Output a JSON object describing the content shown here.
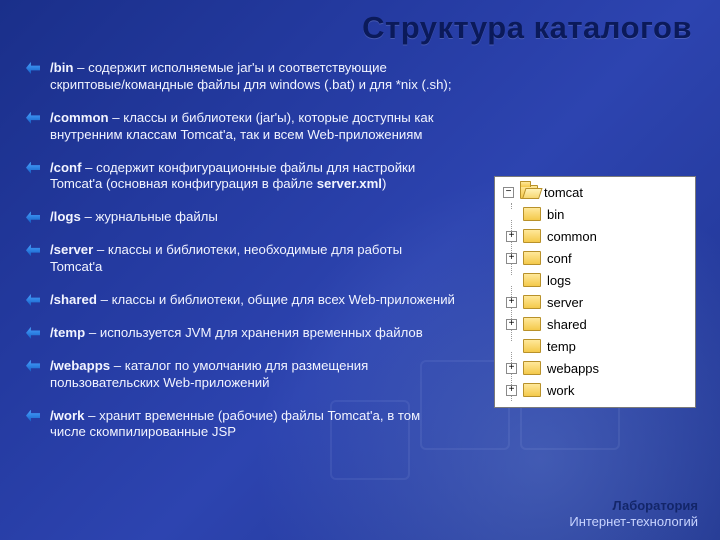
{
  "title": "Структура каталогов",
  "bullets": [
    {
      "name": "/bin",
      "desc": " – содержит исполняемые jar'ы и соответствующие скриптовые/командные файлы для windows (.bat) и для *nix (.sh);"
    },
    {
      "name": "/common",
      "desc": " – классы и библиотеки (jar'ы), которые доступны как внутренним классам Tomcat'а, так и всем Web-приложениям"
    },
    {
      "name": "/conf",
      "desc": " – содержит конфигурационные файлы для настройки Tomcat'а (основная конфигурация в файле ",
      "hl": "server.xml",
      "desc2": ")"
    },
    {
      "name": "/logs",
      "desc": " – журнальные файлы"
    },
    {
      "name": "/server",
      "desc": " – классы и библиотеки, необходимые для работы Tomcat'а"
    },
    {
      "name": "/shared",
      "desc": " – классы и библиотеки, общие для всех Web-приложений"
    },
    {
      "name": "/temp",
      "desc": " – используется JVM для хранения временных файлов"
    },
    {
      "name": "/webapps",
      "desc": " – каталог по умолчанию для размещения пользовательских Web-приложений"
    },
    {
      "name": "/work",
      "desc": " – хранит временные (рабочие) файлы Tomcat'а, в том числе скомпилированные JSP"
    }
  ],
  "tree": {
    "root": {
      "label": "tomcat",
      "sign": "−"
    },
    "children": [
      {
        "label": "bin",
        "sign": ""
      },
      {
        "label": "common",
        "sign": "+"
      },
      {
        "label": "conf",
        "sign": "+"
      },
      {
        "label": "logs",
        "sign": ""
      },
      {
        "label": "server",
        "sign": "+"
      },
      {
        "label": "shared",
        "sign": "+"
      },
      {
        "label": "temp",
        "sign": ""
      },
      {
        "label": "webapps",
        "sign": "+"
      },
      {
        "label": "work",
        "sign": "+"
      }
    ]
  },
  "footer": {
    "lab": "Лаборатория",
    "sub": "Интернет-технологий"
  }
}
